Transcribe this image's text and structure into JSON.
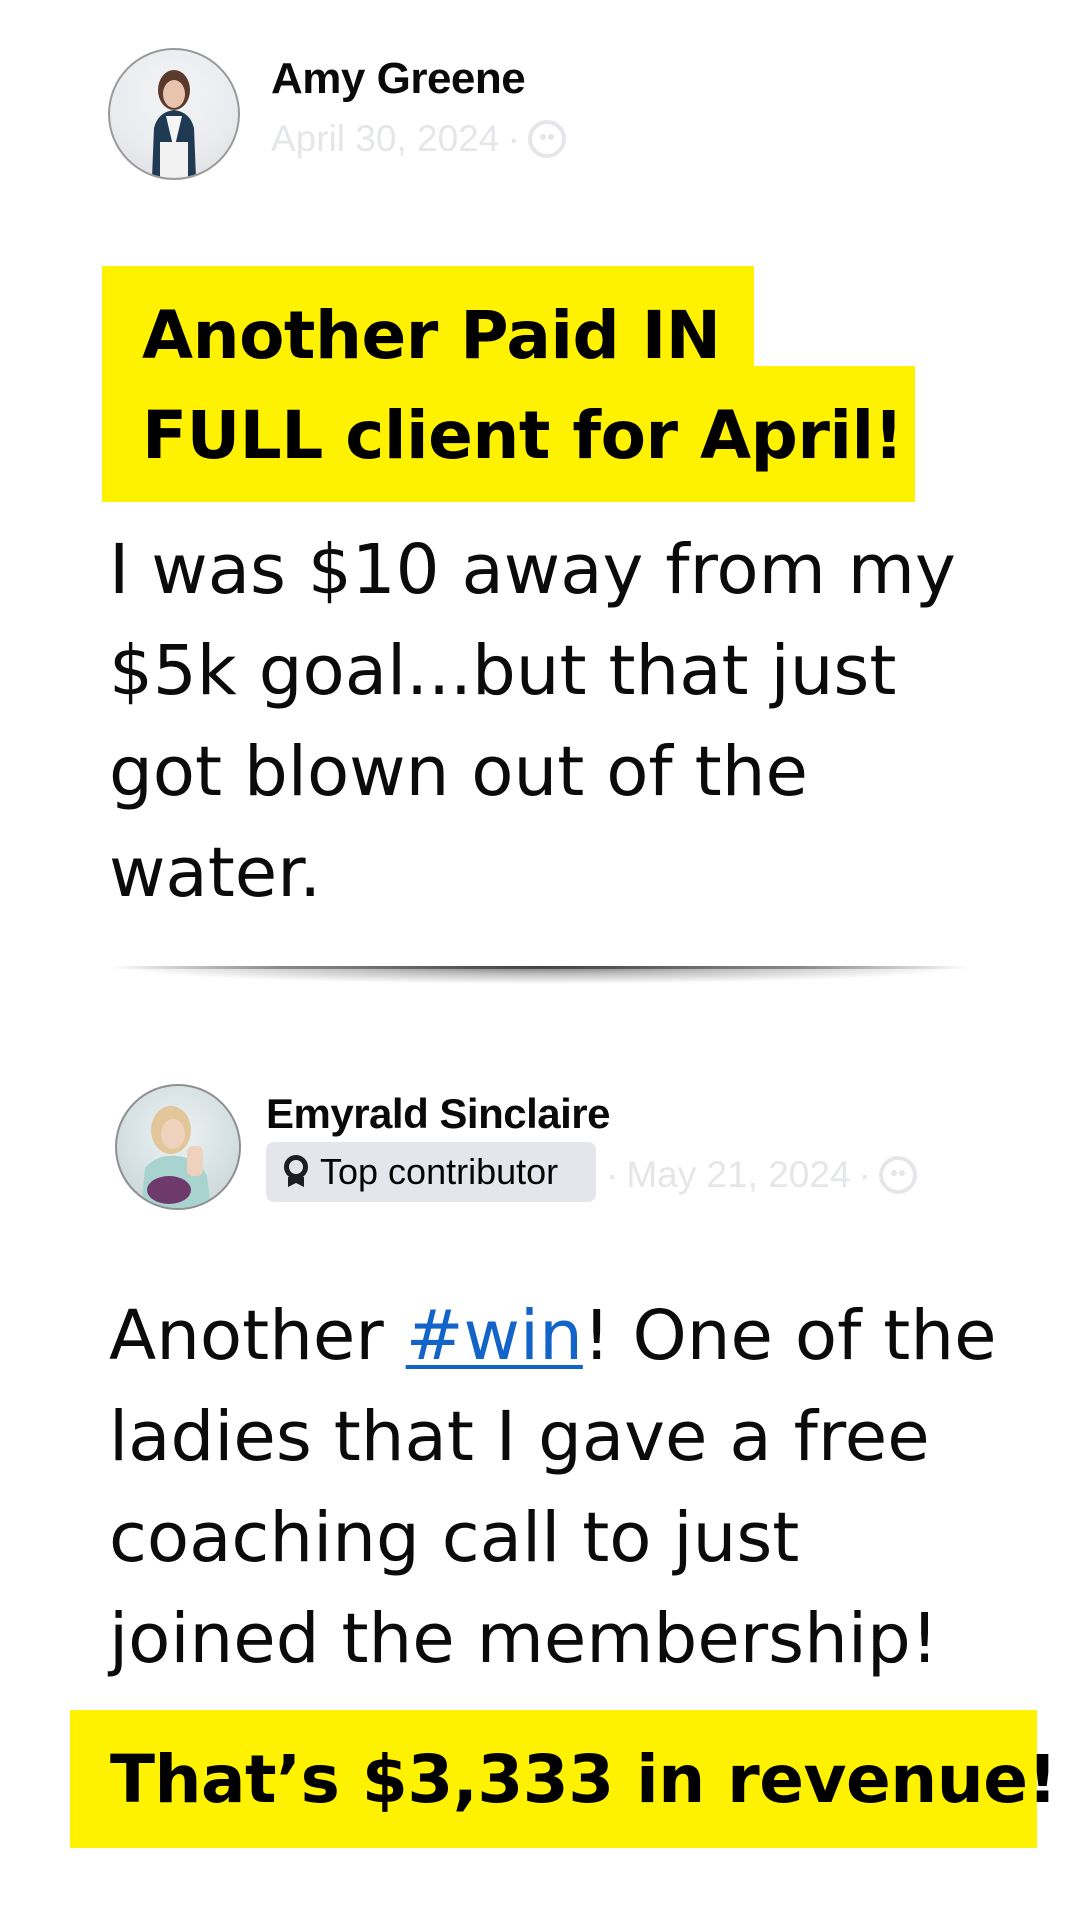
{
  "post1": {
    "author_name": "Amy Greene",
    "date": "April 30, 2024",
    "separator": "·",
    "audience_icon": "globe-icon",
    "headline": {
      "line1": "Another Paid IN",
      "line2": "FULL client for April!"
    },
    "body": {
      "line1": "I was $10 away from my",
      "line2": "$5k goal...but that just",
      "line3": "got blown out of the",
      "line4": "water."
    }
  },
  "post2": {
    "author_name": "Emyrald Sinclaire",
    "badge_label": "Top contributor",
    "badge_icon": "medal-icon",
    "date": "May 21, 2024",
    "separator": "·",
    "audience_icon": "globe-icon",
    "body": {
      "line1_before": "Another ",
      "hashtag": "#win",
      "line1_after": "! One of the",
      "line2": "ladies that I gave a free",
      "line3": "coaching call to just",
      "line4": "joined the membership!"
    },
    "highlight": "That’s $3,333 in revenue!"
  },
  "colors": {
    "highlight_yellow": "#fff200",
    "hashtag_blue": "#1264c8",
    "faded_meta": "#e4e6ea",
    "badge_bg": "#e4e6eb"
  }
}
